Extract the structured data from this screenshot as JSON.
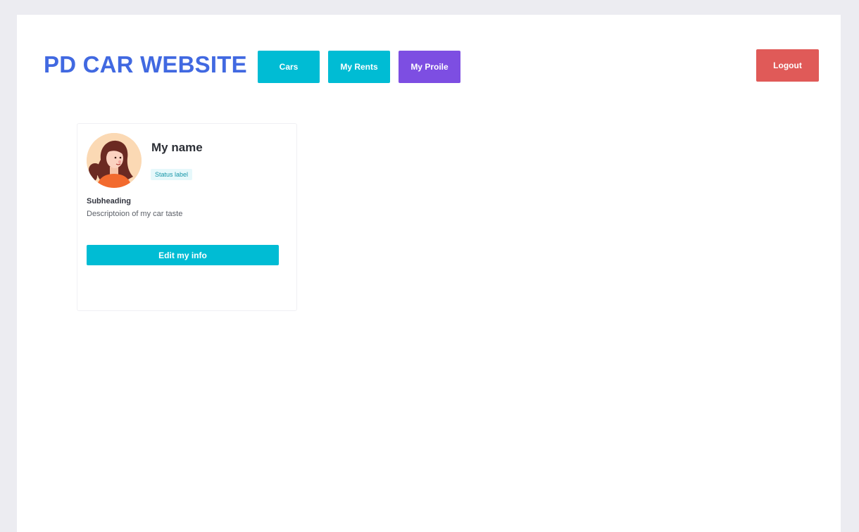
{
  "header": {
    "brand": "PD CAR WEBSITE",
    "nav": {
      "cars": "Cars",
      "my_rents": "My Rents",
      "my_profile": "My Proile"
    },
    "logout": "Logout"
  },
  "profile_card": {
    "name": "My name",
    "status_label": "Status label",
    "subheading": "Subheading",
    "description": "Descriptoion of my car taste",
    "edit_button": "Edit my info",
    "avatar_icon": "woman-avatar-icon"
  },
  "colors": {
    "brand": "#4169e1",
    "primary_button": "#00bcd4",
    "active_nav": "#7d4ee2",
    "logout": "#e05a58"
  }
}
